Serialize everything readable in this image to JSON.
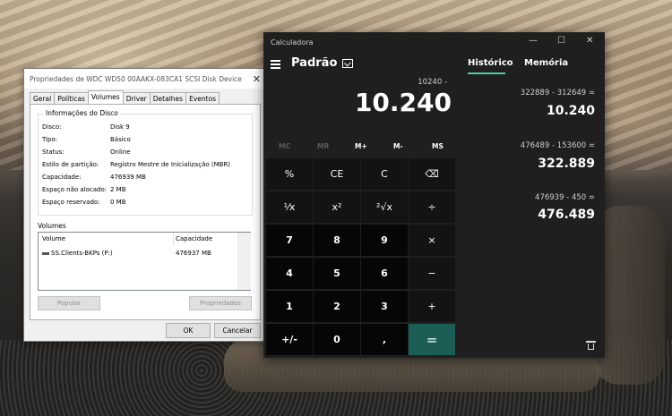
{
  "properties_dialog": {
    "title": "Propriedades de WDC WD50 00AAKX-083CA1 SCSI Disk Device",
    "close_glyph": "✕",
    "tabs": [
      "Geral",
      "Políticas",
      "Volumes",
      "Driver",
      "Detalhes",
      "Eventos"
    ],
    "active_tab": "Volumes",
    "disk_info": {
      "group_title": "Informações do Disco",
      "rows": [
        {
          "label": "Disco:",
          "value": "Disk 9"
        },
        {
          "label": "Tipo:",
          "value": "Básico"
        },
        {
          "label": "Status:",
          "value": "Online"
        },
        {
          "label": "Estilo de partição:",
          "value": "Registro Mestre de Inicialização (MBR)"
        },
        {
          "label": "Capacidade:",
          "value": "476939 MB"
        },
        {
          "label": "Espaço não alocado:",
          "value": "2 MB"
        },
        {
          "label": "Espaço reservado:",
          "value": "0 MB"
        }
      ]
    },
    "volumes": {
      "label": "Volumes",
      "headers": [
        "Volume",
        "Capacidade"
      ],
      "rows": [
        {
          "volume": "SS.Clients-BKPs (P:)",
          "capacity": "476937 MB"
        }
      ]
    },
    "buttons": {
      "populate": "Popular",
      "properties": "Propriedades",
      "ok": "OK",
      "cancel": "Cancelar"
    }
  },
  "calculator": {
    "title": "Calculadora",
    "window_controls": {
      "minimize": "—",
      "maximize": "☐",
      "close": "✕"
    },
    "mode": "Padrão",
    "expression": "10240 -",
    "display": "10.240",
    "memory_buttons": [
      "MC",
      "MR",
      "M+",
      "M-",
      "MS"
    ],
    "keys": [
      [
        "%",
        "CE",
        "C",
        "⌫"
      ],
      [
        "¹⁄x",
        "x²",
        "²√x",
        "÷"
      ],
      [
        "7",
        "8",
        "9",
        "×"
      ],
      [
        "4",
        "5",
        "6",
        "−"
      ],
      [
        "1",
        "2",
        "3",
        "+"
      ],
      [
        "+/-",
        "0",
        ",",
        "="
      ]
    ],
    "history_tabs": {
      "history": "Histórico",
      "memory": "Memória"
    },
    "history": [
      {
        "expression": "322889  -  312649 =",
        "result": "10.240"
      },
      {
        "expression": "476489  -  153600 =",
        "result": "322.889"
      },
      {
        "expression": "476939  -  450 =",
        "result": "476.489"
      }
    ],
    "accent_color": "#4ec9b0"
  }
}
